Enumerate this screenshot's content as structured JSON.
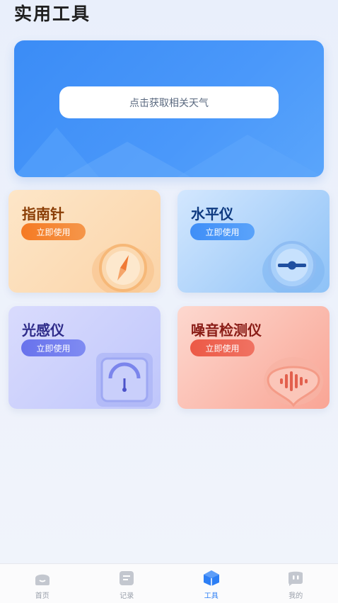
{
  "page": {
    "title": "实用工具"
  },
  "weather": {
    "button_label": "点击获取相关天气"
  },
  "tools": [
    {
      "title": "指南针",
      "button": "立即使用",
      "icon": "compass-icon"
    },
    {
      "title": "水平仪",
      "button": "立即使用",
      "icon": "level-icon"
    },
    {
      "title": "光感仪",
      "button": "立即使用",
      "icon": "light-meter-icon"
    },
    {
      "title": "噪音检测仪",
      "button": "立即使用",
      "icon": "sound-wave-icon"
    }
  ],
  "tabbar": {
    "active": 2,
    "items": [
      {
        "label": "首页",
        "icon": "home-icon"
      },
      {
        "label": "记录",
        "icon": "record-icon"
      },
      {
        "label": "工具",
        "icon": "tools-cube-icon"
      },
      {
        "label": "我的",
        "icon": "profile-icon"
      }
    ]
  },
  "colors": {
    "accent": "#2d7ff5",
    "weather_card": "#4494f8",
    "compass_btn": "#f57a23",
    "level_btn": "#3f8ef7",
    "light_btn": "#6872ec",
    "noise_btn": "#ec5946"
  }
}
